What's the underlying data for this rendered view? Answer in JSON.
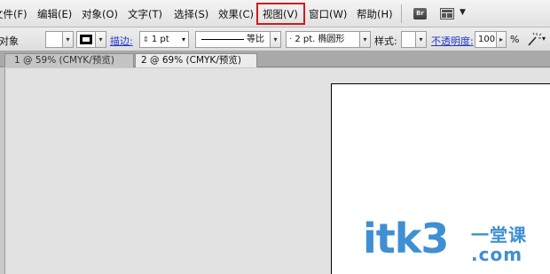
{
  "menu": {
    "items": [
      "文件(F)",
      "编辑(E)",
      "对象(O)",
      "文字(T)",
      "选择(S)",
      "效果(C)",
      "视图(V)",
      "窗口(W)",
      "帮助(H)"
    ],
    "highlighted": "视图(V)",
    "highlight_color": "#d0191c",
    "bridge_label": "Br"
  },
  "control": {
    "selection_label": "对象",
    "stroke_label": "描边:",
    "stroke_weight": "1 pt",
    "profile_label": "等比",
    "brush_label": "2 pt. 椭圆形",
    "style_label": "样式:",
    "opacity_label": "不透明度:",
    "opacity_value": "100",
    "opacity_unit": "%",
    "link_color": "#2337c8"
  },
  "tabs": [
    {
      "label": "1 @ 59% (CMYK/预览)",
      "active": false
    },
    {
      "label": "2 @ 69% (CMYK/预览)",
      "active": true
    }
  ],
  "watermark": {
    "text": "itk3",
    "sub_text": "一堂课",
    "sub_text2": ".com",
    "color": "#3f8fd3"
  }
}
